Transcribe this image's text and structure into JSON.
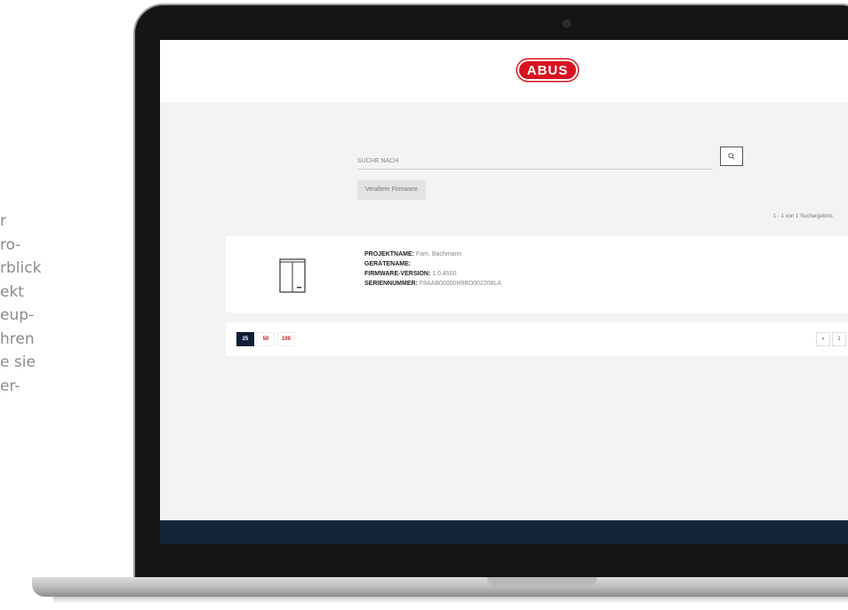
{
  "side_text": [
    "r",
    "ro-",
    "rblick",
    "ekt",
    "eup-",
    "hren",
    "e sie",
    "er-"
  ],
  "app": {
    "logo_text": "ABUS",
    "search": {
      "placeholder": "SUCHE NACH"
    },
    "filter_button": "Veraltete Firmware",
    "results_count": "1 - 1 von 1 Suchergebnis",
    "result": {
      "project_label": "PROJEKTNAME:",
      "project_value": "Fam. Bachmann",
      "device_label": "GERÄTENAME:",
      "device_value": "",
      "firmware_label": "FIRMWARE-VERSION:",
      "firmware_value": "1.0.4500",
      "serial_label": "SERIENNUMMER:",
      "serial_value": "F8AAB00000H9BD002208LA"
    },
    "page_sizes": [
      "25",
      "50",
      "100"
    ],
    "pagination": {
      "prev": "«",
      "page": "1"
    }
  },
  "colors": {
    "brand_red": "#d9121f",
    "navy": "#13233a",
    "active_page_size": "#0f1e36"
  }
}
